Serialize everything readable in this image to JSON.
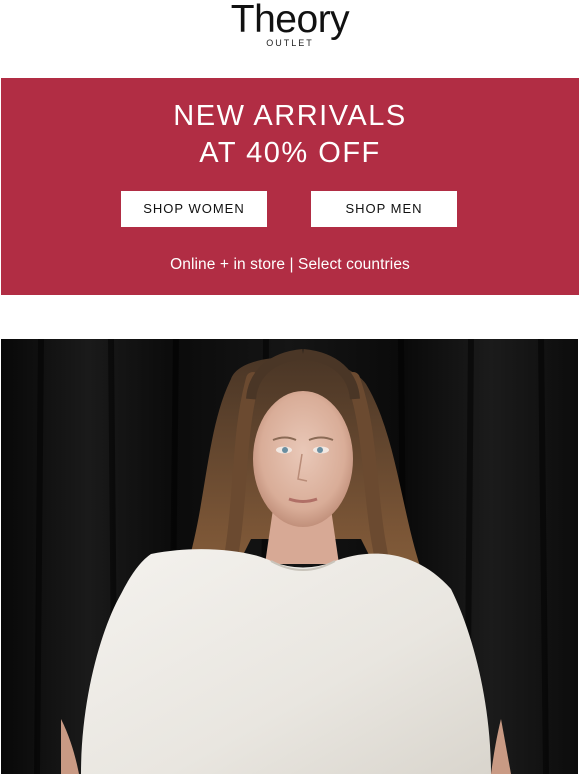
{
  "brand": {
    "name": "Theory",
    "sub": "OUTLET"
  },
  "banner": {
    "background": "#b12d44",
    "headline_line1": "NEW ARRIVALS",
    "headline_line2": "AT 40% OFF",
    "shop_women_label": "SHOP WOMEN",
    "shop_men_label": "SHOP MEN",
    "note": "Online + in store | Select countries"
  },
  "hero": {
    "description_icon": "model-photo"
  }
}
